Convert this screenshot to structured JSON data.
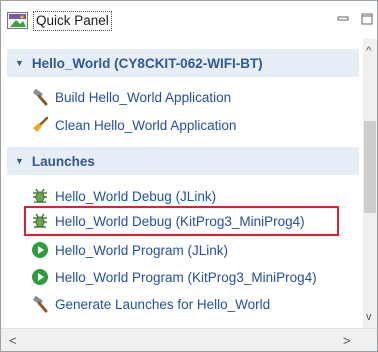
{
  "panel": {
    "title": "Quick Panel"
  },
  "sections": [
    {
      "label": "Hello_World (CY8CKIT-062-WIFI-BT)",
      "items": [
        {
          "label": "Build Hello_World Application",
          "icon": "hammer-icon"
        },
        {
          "label": "Clean Hello_World Application",
          "icon": "broom-icon"
        }
      ]
    },
    {
      "label": "Launches",
      "items": [
        {
          "label": "Hello_World Debug (JLink)",
          "icon": "bug-icon"
        },
        {
          "label": "Hello_World Debug (KitProg3_MiniProg4)",
          "icon": "bug-icon",
          "highlighted": true
        },
        {
          "label": "Hello_World Program (JLink)",
          "icon": "play-icon"
        },
        {
          "label": "Hello_World Program (KitProg3_MiniProg4)",
          "icon": "play-icon"
        },
        {
          "label": "Generate Launches for Hello_World",
          "icon": "hammer-icon"
        }
      ]
    }
  ],
  "colors": {
    "link": "#2450a0",
    "section_bg": "#e8eef7",
    "highlight_border": "#e01f2f",
    "play_green": "#2e9e3e"
  }
}
